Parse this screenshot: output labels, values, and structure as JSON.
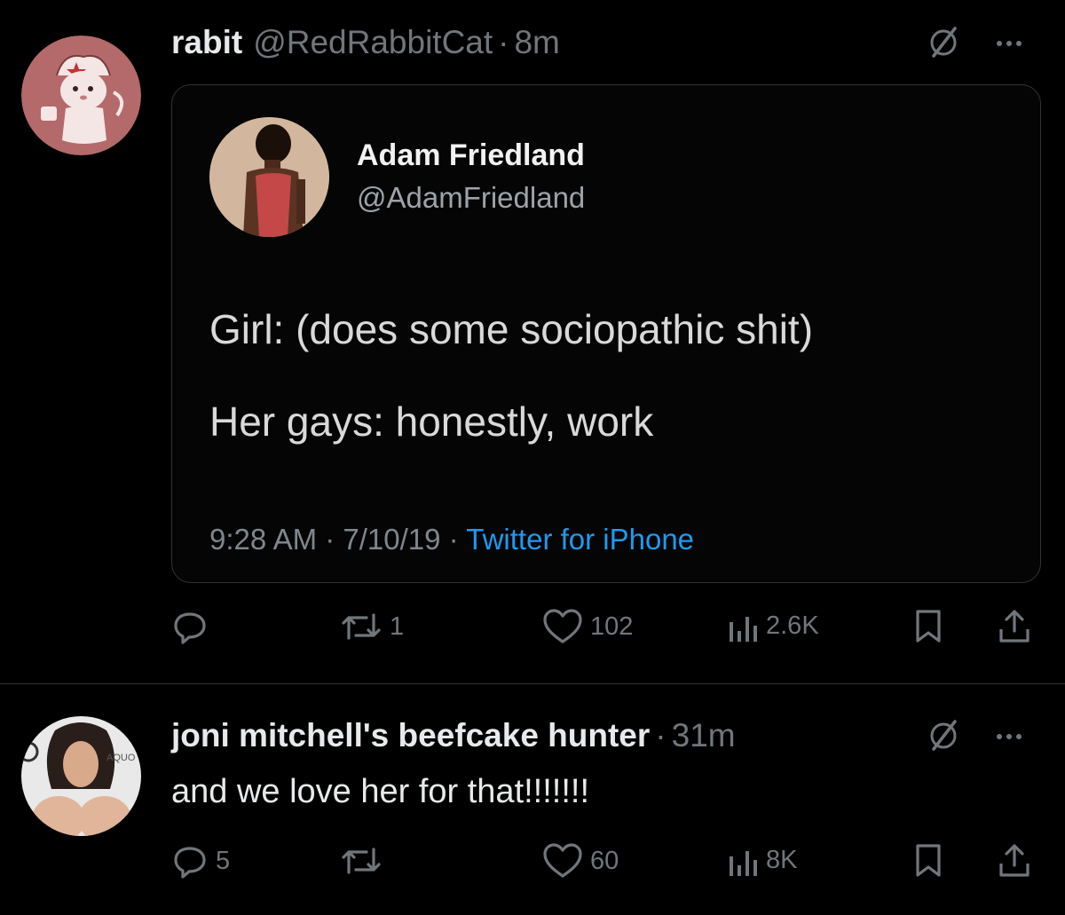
{
  "tweet1": {
    "name": "rabit",
    "handle": "@RedRabbitCat",
    "dot": "·",
    "time": "8m",
    "avatar_icon": "rabbit-cat-avatar",
    "quote": {
      "name": "Adam Friedland",
      "handle": "@AdamFriedland",
      "line1": "Girl: (does some sociopathic shit)",
      "line2": "Her gays: honestly, work",
      "timestamp": "9:28 AM · 7/10/19 ·",
      "source": "Twitter for iPhone"
    },
    "actions": {
      "replies": "",
      "retweets": "1",
      "likes": "102",
      "views": "2.6K"
    }
  },
  "tweet2": {
    "name": "joni mitchell's beefcake hunter",
    "dot": "·",
    "time": "31m",
    "text": "and we love her for that!!!!!!!",
    "avatar_label": "AQUO",
    "actions": {
      "replies": "5",
      "retweets": "",
      "likes": "60",
      "views": "8K"
    }
  },
  "colors": {
    "background": "#000000",
    "text": "#e7e9ea",
    "muted": "#71767b",
    "link": "#1d9bf0",
    "border": "#2f3336"
  },
  "icons": [
    "mute-icon",
    "more-icon",
    "reply-icon",
    "retweet-icon",
    "like-icon",
    "views-icon",
    "bookmark-icon",
    "share-icon"
  ]
}
